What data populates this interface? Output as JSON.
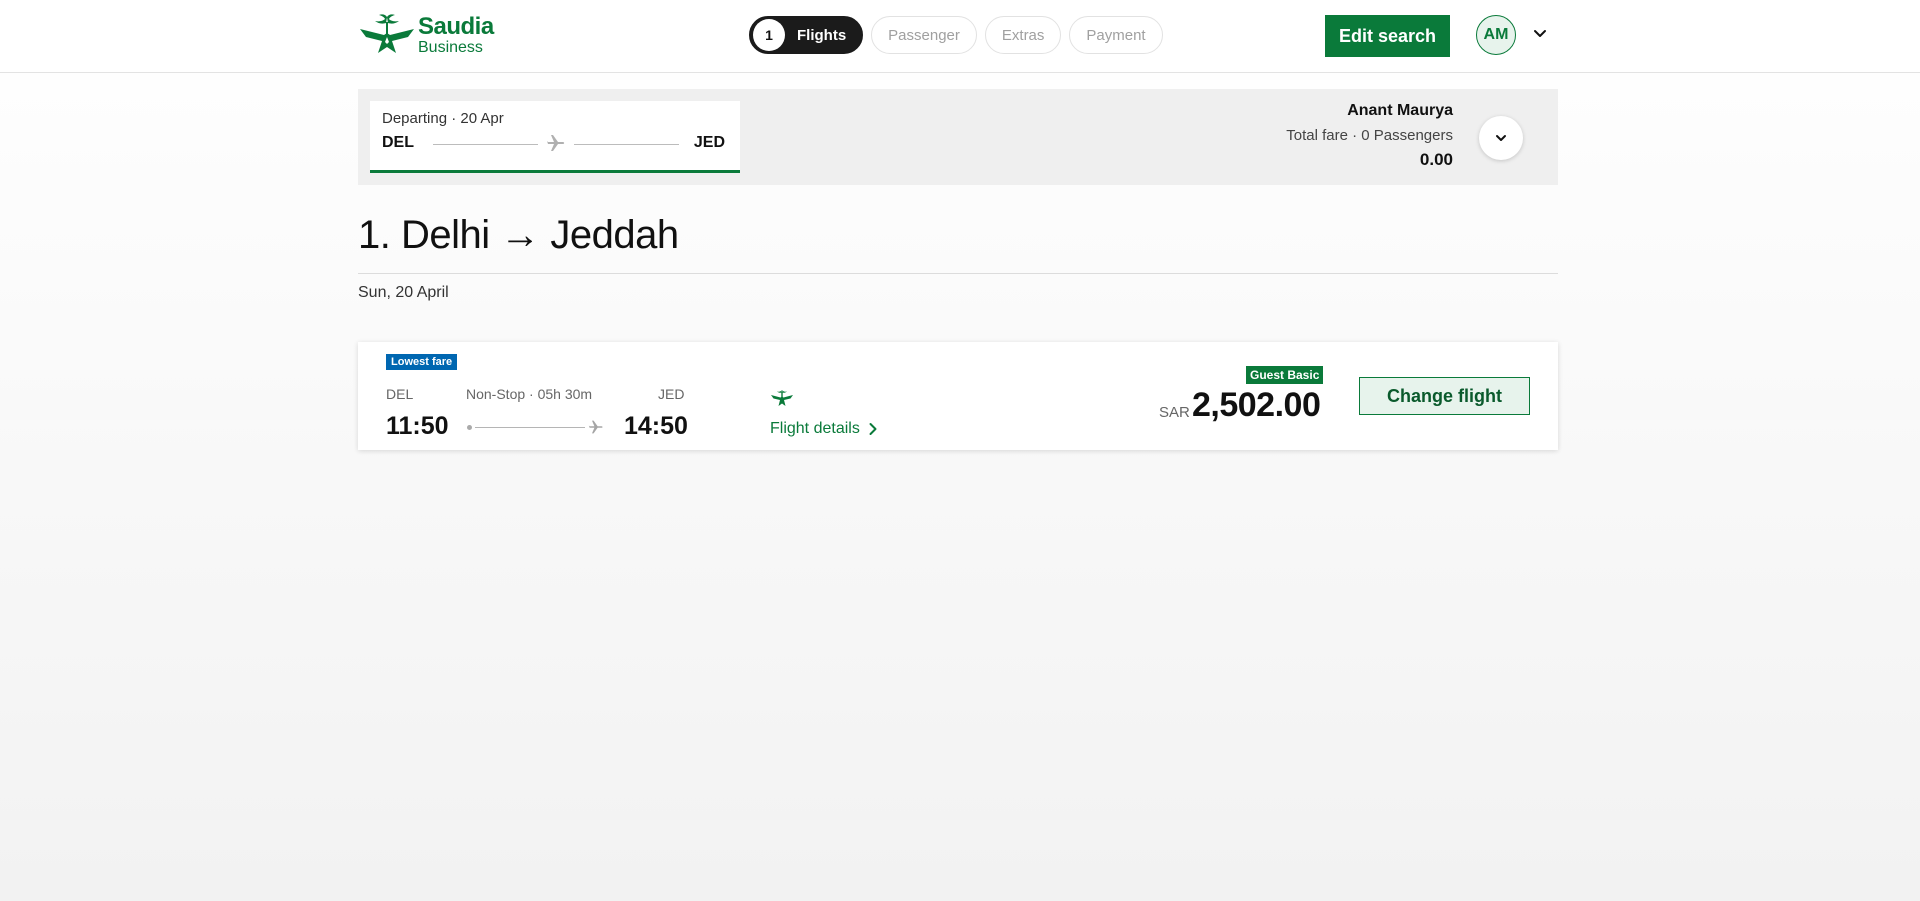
{
  "header": {
    "logo": {
      "brand": "Saudia",
      "sub": "Business"
    },
    "steps": [
      {
        "num": "1",
        "label": "Flights",
        "active": true
      },
      {
        "label": "Passenger"
      },
      {
        "label": "Extras"
      },
      {
        "label": "Payment"
      }
    ],
    "edit_search_label": "Edit search",
    "user_initials": "AM"
  },
  "summary": {
    "segment": {
      "date_label": "Departing · 20 Apr",
      "from": "DEL",
      "to": "JED"
    },
    "passenger_name": "Anant Maurya",
    "fare_label": "Total fare · 0 Passengers",
    "total": "0.00"
  },
  "route": {
    "title": "1. Delhi → Jeddah",
    "date": "Sun, 20 April"
  },
  "flight": {
    "badge": "Lowest fare",
    "dep_code": "DEL",
    "dep_time": "11:50",
    "stop_info": "Non-Stop · 05h 30m",
    "arr_code": "JED",
    "arr_time": "14:50",
    "details_label": "Flight details",
    "fare_badge": "Guest Basic",
    "currency": "SAR",
    "price": "2,502.00",
    "change_label": "Change flight"
  },
  "colors": {
    "brand_green": "#0a7a3a",
    "lowest_badge_blue": "#0067b1",
    "dark": "#1b1b1b"
  },
  "icons": [
    "saudia-logo-icon",
    "plane-icon",
    "chevron-down-icon",
    "chevron-right-icon",
    "airline-icon"
  ]
}
